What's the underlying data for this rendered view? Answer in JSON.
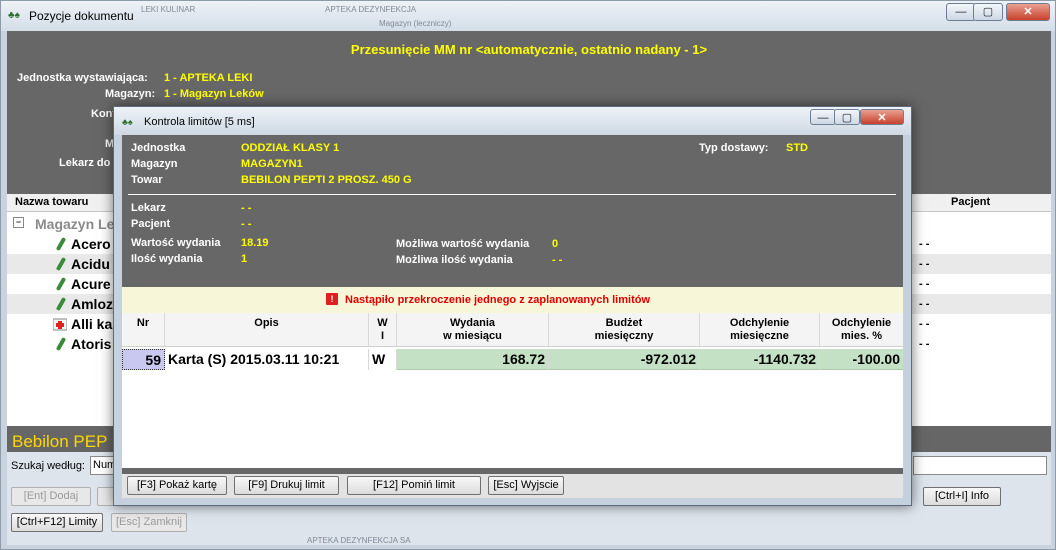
{
  "window": {
    "title": "Pozycje dokumentu",
    "ghost_title": "APTEKA DEZYNFEKCJA",
    "ghost_subtitle": "Magazyn (leczniczy)",
    "ghost_left": "LEKI KULINAR",
    "buttons": {
      "minimize": "—",
      "maximize": "▢",
      "close": "✕"
    }
  },
  "document": {
    "title": "Przesunięcie MM nr <automatycznie, ostatnio nadany - 1>",
    "labels": {
      "jednostka": "Jednostka wystawiająca:",
      "magazyn": "Magazyn:",
      "kontrahent": "Kontra",
      "m": "M",
      "lekarz": "Lekarz do"
    },
    "values": {
      "jednostka": "1 - APTEKA LEKI",
      "magazyn": "1 - Magazyn Leków"
    }
  },
  "tree": {
    "header_name": "Nazwa towaru",
    "header_patient": "Pacjent",
    "root": "Magazyn Le",
    "items": [
      "Acero",
      "Acidu",
      "Acure",
      "Amloz",
      "Alli ka",
      "Atoris"
    ],
    "patient_values": [
      "- -",
      "- -",
      "- -",
      "- -",
      "- -",
      "- -"
    ]
  },
  "bottom": {
    "product_title": "Bebilon PEP",
    "search_label": "Szukaj według:",
    "search_value": "Num",
    "buttons": {
      "dodaj": "[Ent] Dodaj",
      "info": "[Ctrl+I] Info",
      "limity": "[Ctrl+F12] Limity",
      "zamknij": "[Esc] Zamknij"
    },
    "ghost_footer": "APTEKA DEZYNFEKCJA SA"
  },
  "dialog": {
    "title": "Kontrola limitów   [5 ms]",
    "buttons": {
      "minimize": "—",
      "maximize": "▢",
      "close": "✕"
    },
    "labels": {
      "jednostka": "Jednostka",
      "magazyn": "Magazyn",
      "towar": "Towar",
      "typ_dostawy": "Typ dostawy:",
      "lekarz": "Lekarz",
      "pacjent": "Pacjent",
      "wartosc": "Wartość wydania",
      "ilosc": "Ilość wydania",
      "mozliwa_wartosc": "Możliwa wartość wydania",
      "mozliwa_ilosc": "Możliwa ilość wydania"
    },
    "values": {
      "jednostka": "ODDZIAŁ KLASY 1",
      "magazyn": "MAGAZYN1",
      "towar": "BEBILON PEPTI 2 PROSZ. 450 G",
      "typ_dostawy": "STD",
      "lekarz": "- -",
      "pacjent": "- -",
      "wartosc": "18.19",
      "ilosc": "1",
      "mozliwa_wartosc": "0",
      "mozliwa_ilosc": "- -"
    },
    "warning": "Nastąpiło przekroczenie jednego z zaplanowanych limitów",
    "warning_icon": "!",
    "grid": {
      "headers": {
        "nr": "Nr",
        "opis": "Opis",
        "w1": "W",
        "w2": "I",
        "wyd1": "Wydania",
        "wyd2": "w miesiącu",
        "bud1": "Budżet",
        "bud2": "miesięczny",
        "odch1": "Odchylenie",
        "odch2": "miesięczne",
        "odp1": "Odchylenie",
        "odp2": "mies. %"
      },
      "row": {
        "nr": "59",
        "opis": "Karta (S) 2015.03.11 10:21",
        "wi": "W",
        "wydania": "168.72",
        "budzet": "-972.012",
        "odchylenie": "-1140.732",
        "odchylenie_proc": "-100.00"
      }
    },
    "action_buttons": {
      "pokaz": "[F3] Pokaż kartę",
      "drukuj": "[F9] Drukuj limit",
      "pomin": "[F12] Pomiń limit",
      "wyjscie": "[Esc] Wyjscie"
    }
  }
}
